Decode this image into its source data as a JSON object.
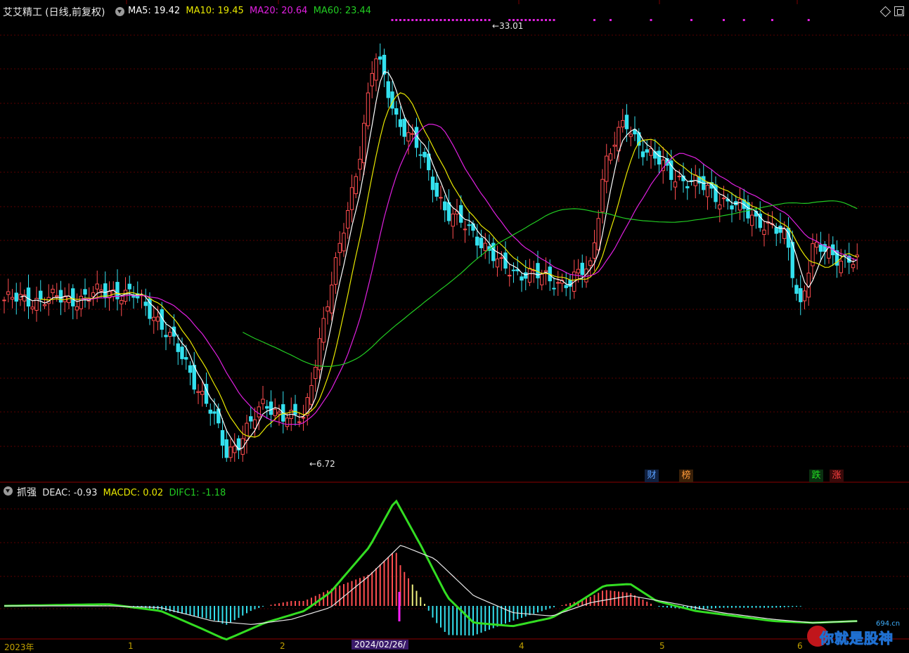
{
  "main_panel": {
    "stock_name": "艾艾精工",
    "period": "(日线,前复权)",
    "ma5_label": "MA5: 19.42",
    "ma10_label": "MA10: 19.45",
    "ma20_label": "MA20: 20.64",
    "ma60_label": "MA60: 23.44",
    "high_label": "33.01",
    "low_label": "6.72",
    "high_price": 33.01,
    "low_price": 6.72,
    "colors": {
      "up": "#ff4d4f",
      "down": "#33e0ee",
      "ma5": "#ffffff",
      "ma10": "#e8e800",
      "ma20": "#e020e0",
      "ma60": "#22cc22"
    }
  },
  "event_badges": [
    {
      "name": "badge-cai",
      "text": "财",
      "color": "#5aa0ff"
    },
    {
      "name": "badge-bang",
      "text": "榜",
      "color": "#ff9a3a"
    },
    {
      "name": "badge-die",
      "text": "跌",
      "color": "#22dd22"
    },
    {
      "name": "badge-zhang",
      "text": "涨",
      "color": "#ff4040"
    }
  ],
  "sub_panel": {
    "indicator_name": "抓强",
    "deac_label": "DEAC: -0.93",
    "macdc_label": "MACDC: 0.02",
    "difc1_label": "DIFC1: -1.18"
  },
  "x_axis": {
    "dates": [
      "2023年",
      "1",
      "2",
      "2024/02/26/",
      "4",
      "5",
      "6"
    ]
  },
  "watermark": {
    "domain": "694.cn",
    "brand": "你就是股神"
  }
}
